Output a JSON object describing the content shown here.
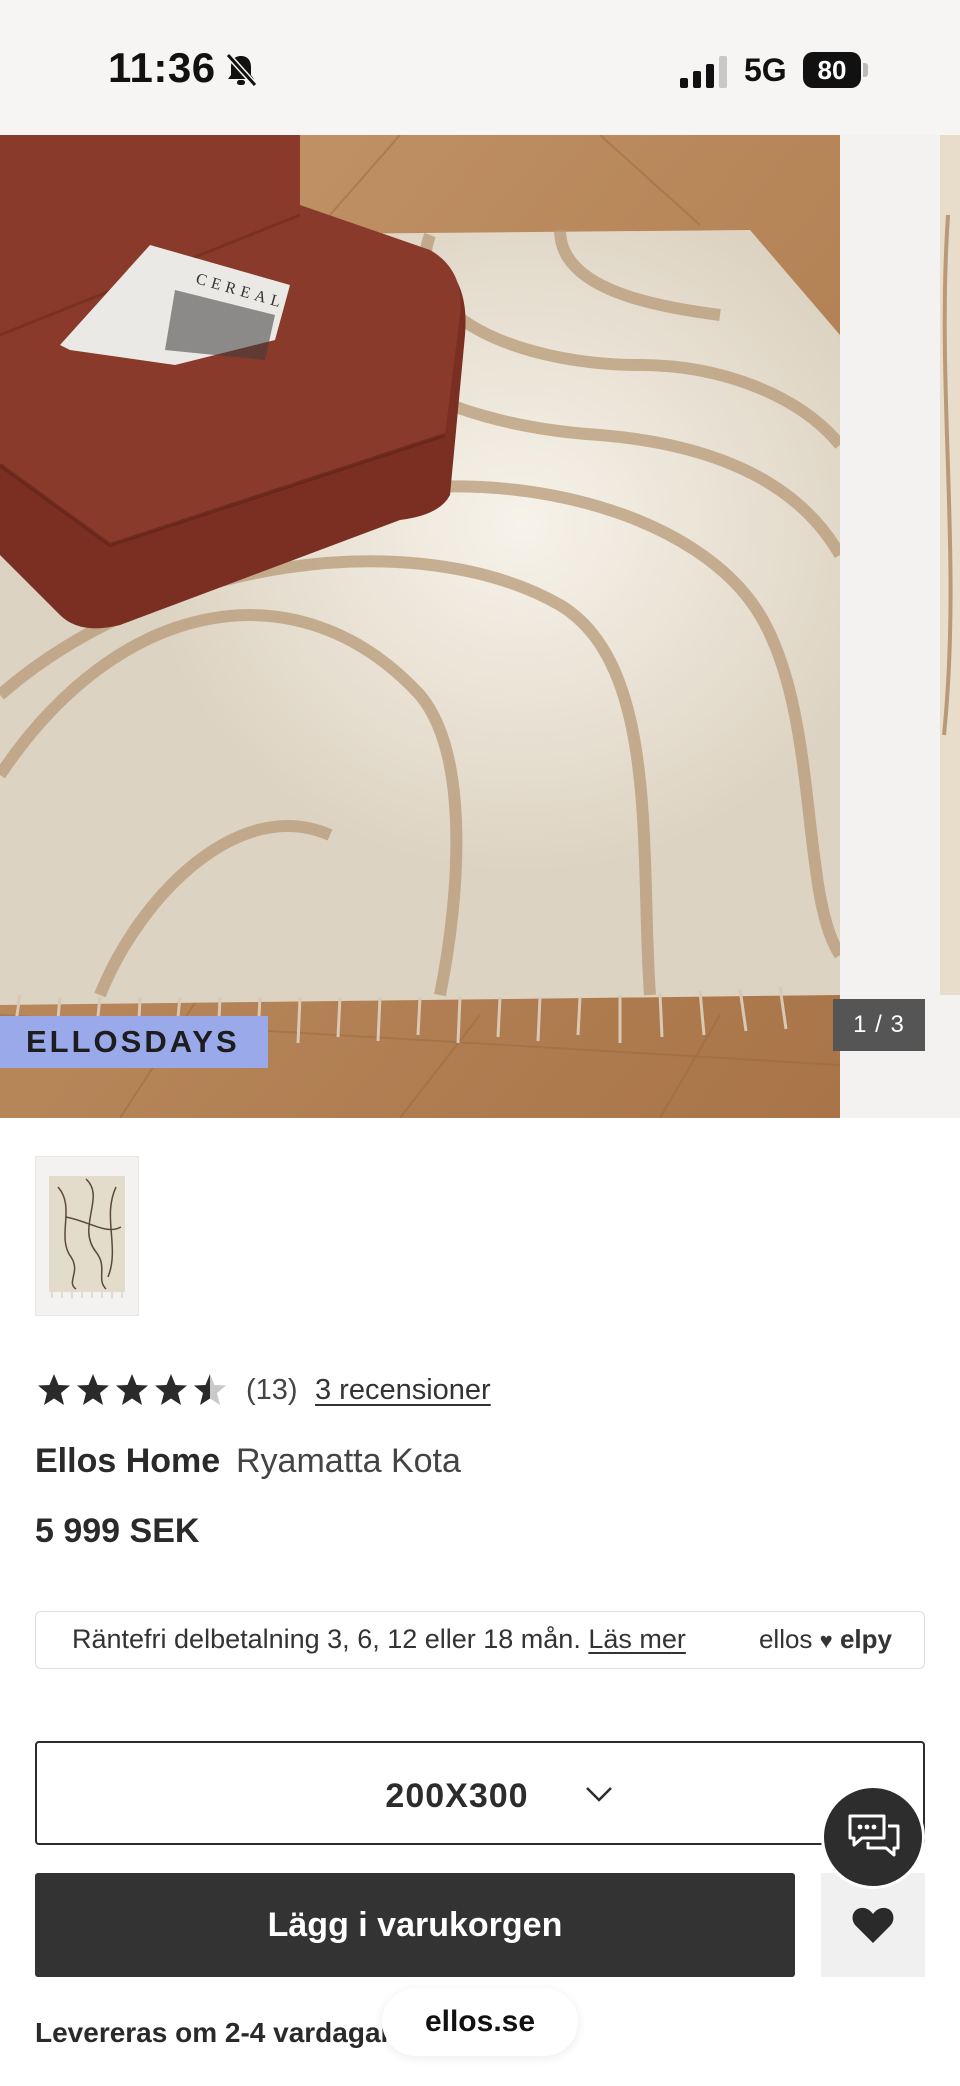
{
  "status_bar": {
    "time": "11:36",
    "network": "5G",
    "battery": "80"
  },
  "gallery": {
    "badge": "ELLOSDAYS",
    "counter": "1 / 3"
  },
  "rating": {
    "value": 4.5,
    "max": 5,
    "count": "(13)",
    "reviews_link": "3 recensioner"
  },
  "product": {
    "brand": "Ellos Home",
    "name": "Ryamatta Kota",
    "price": "5 999 SEK"
  },
  "financing": {
    "text": "Räntefri delbetalning 3, 6, 12 eller 18 mån.",
    "link": "Läs mer",
    "logo_left": "ellos",
    "logo_right": "elpy"
  },
  "size": {
    "selected": "200X300"
  },
  "actions": {
    "add_to_cart": "Lägg i varukorgen"
  },
  "delivery": {
    "text": "Levereras om 2-4 vardagar"
  },
  "browser": {
    "domain": "ellos.se"
  },
  "colors": {
    "badge": "#99a9e9",
    "button": "#333333",
    "background": "#ffffff",
    "statusbar": "#f6f5f3"
  }
}
